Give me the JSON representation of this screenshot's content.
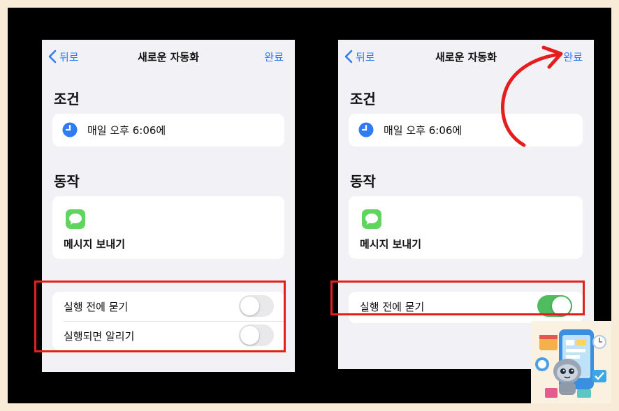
{
  "left_screen": {
    "nav": {
      "back_label": "뒤로",
      "title": "새로운 자동화",
      "done_label": "완료"
    },
    "condition_section_title": "조건",
    "condition_text": "매일 오후 6:06에",
    "action_section_title": "동작",
    "action_text": "메시지 보내기",
    "toggles": [
      {
        "label": "실행 전에 묻기",
        "state": "off"
      },
      {
        "label": "실행되면 알리기",
        "state": "off"
      }
    ]
  },
  "right_screen": {
    "nav": {
      "back_label": "뒤로",
      "title": "새로운 자동화",
      "done_label": "완료"
    },
    "condition_section_title": "조건",
    "condition_text": "매일 오후 6:06에",
    "action_section_title": "동작",
    "action_text": "메시지 보내기",
    "toggles": [
      {
        "label": "실행 전에 묻기",
        "state": "on"
      }
    ]
  },
  "colors": {
    "accent_blue": "#2f7cf6",
    "toggle_on": "#4fbd5f",
    "highlight_red": "#e41d1d",
    "background": "#f8ecd8"
  },
  "icons": [
    "chevron-left-icon",
    "clock-icon",
    "messages-icon",
    "arrow-annotation-icon",
    "robot-mascot-icon"
  ]
}
